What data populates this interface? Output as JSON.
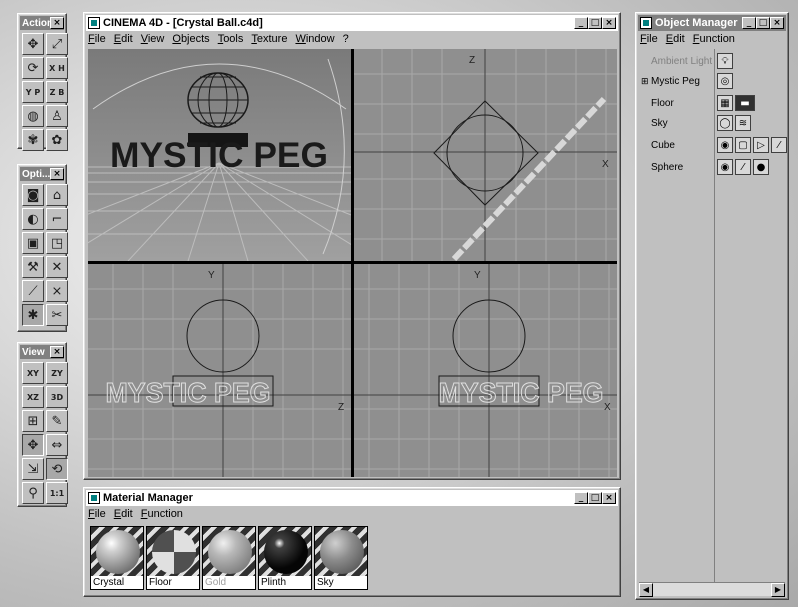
{
  "palettes": {
    "action": {
      "title": "Action",
      "tools": [
        "move-icon",
        "scale-icon",
        "rotate-icon",
        "xyz-icon",
        "x-axis-icon",
        "z-axis-icon",
        "object-icon",
        "coordinate-icon",
        "animation-icon",
        "record-icon"
      ]
    },
    "options": {
      "title": "Opti...",
      "tools": [
        "camera-icon",
        "light-icon",
        "render-icon",
        "texture-icon",
        "edit-icon",
        "select-icon",
        "knife-icon",
        "magnet-icon",
        "figure-icon",
        "brush-icon",
        "smooth-icon",
        "deform-icon"
      ]
    },
    "view": {
      "title": "View",
      "xy_label": "XY",
      "zy_label": "ZY",
      "xz_label": "XZ",
      "3d_label": "3D",
      "one_to_one": "1:1"
    }
  },
  "main_window": {
    "title": "CINEMA 4D - [Crystal Ball.c4d]",
    "menu": [
      "File",
      "Edit",
      "View",
      "Objects",
      "Tools",
      "Texture",
      "Window",
      "?"
    ]
  },
  "viewports": {
    "perspective": {
      "scene_text": "MYSTIC PEG"
    },
    "front": {
      "axis_vertical": "Z",
      "axis_horizontal": "X"
    },
    "side": {
      "axis_vertical": "Y",
      "axis_horizontal": "Z",
      "scene_text": "MYSTIC PEG"
    },
    "top": {
      "axis_vertical": "Y",
      "axis_horizontal": "X",
      "scene_text": "MYSTIC PEG"
    }
  },
  "object_manager": {
    "title": "Object Manager",
    "menu": [
      "File",
      "Edit",
      "Function"
    ],
    "objects": [
      {
        "name": "Ambient Light",
        "disabled": true
      },
      {
        "name": "Mystic Peg",
        "disabled": false,
        "expandable": true
      },
      {
        "name": "Floor",
        "disabled": false
      },
      {
        "name": "Sky",
        "disabled": false
      },
      {
        "name": "Cube",
        "disabled": false
      },
      {
        "name": "Sphere",
        "disabled": false
      }
    ]
  },
  "material_manager": {
    "title": "Material Manager",
    "menu": [
      "File",
      "Edit",
      "Function"
    ],
    "materials": [
      {
        "name": "Crystal",
        "color": "#d8d8d8",
        "dim": false
      },
      {
        "name": "Floor",
        "color": "#9a9a9a",
        "dim": false
      },
      {
        "name": "Gold",
        "color": "#b0b0b0",
        "dim": true
      },
      {
        "name": "Plinth",
        "color": "#101010",
        "dim": false
      },
      {
        "name": "Sky",
        "color": "#8c8c8c",
        "dim": false
      }
    ]
  },
  "window_buttons": {
    "minimize": "_",
    "maximize": "□",
    "close": "×"
  }
}
